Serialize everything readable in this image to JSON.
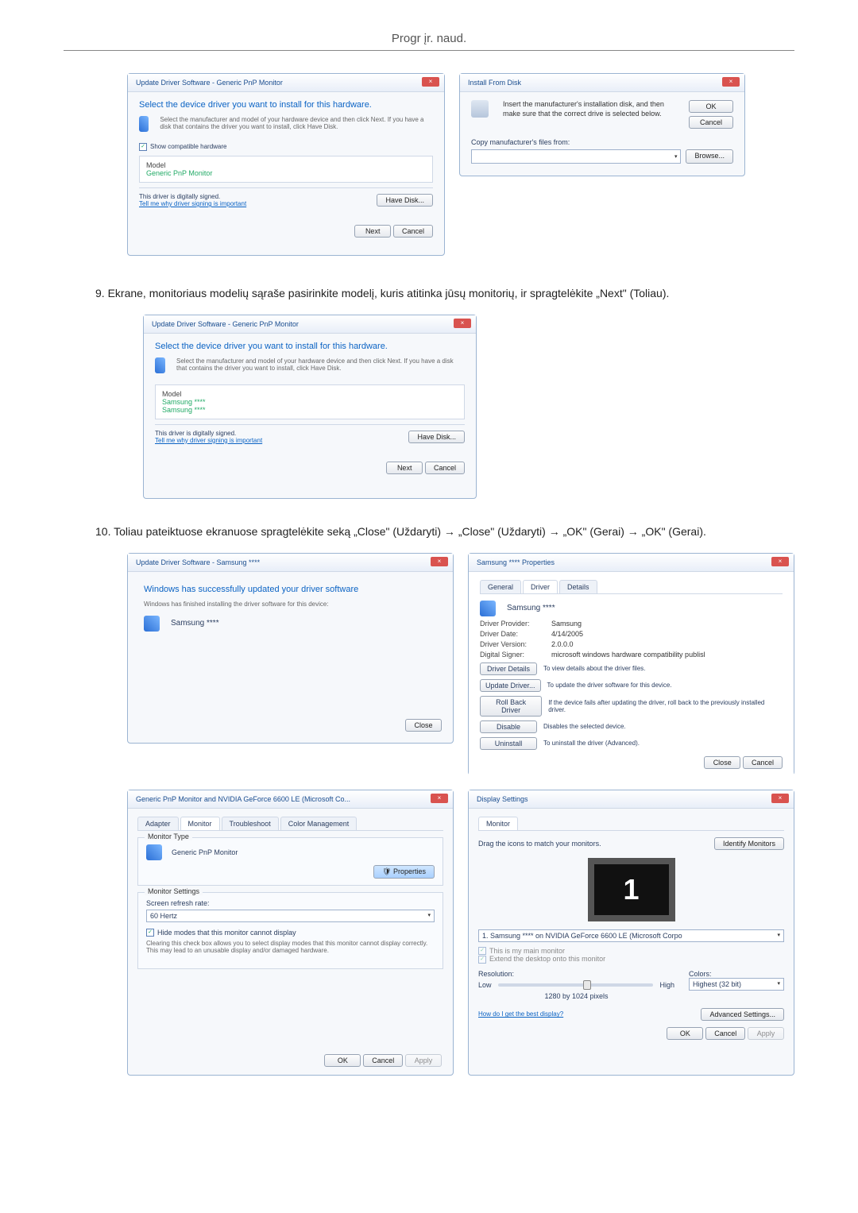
{
  "page_header": "Progr įr. naud.",
  "step9": "9.   Ekrane, monitoriaus modelių sąraše pasirinkite modelį, kuris atitinka jūsų monitorių, ir spragtelėkite „Next\" (Toliau).",
  "step10": "10.  Toliau pateiktuose ekranuose spragtelėkite seką „Close\" (Uždaryti) → „Close\" (Uždaryti) → „OK\" (Gerai) → „OK\" (Gerai).",
  "wiz1": {
    "title": "Update Driver Software - Generic PnP Monitor",
    "hdr": "Select the device driver you want to install for this hardware.",
    "tiny": "Select the manufacturer and model of your hardware device and then click Next. If you have a disk that contains the driver you want to install, click Have Disk.",
    "show_compat": "Show compatible hardware",
    "model_hdr": "Model",
    "model_item": "Generic PnP Monitor",
    "signed": "This driver is digitally signed.",
    "tell_me": "Tell me why driver signing is important",
    "have_disk": "Have Disk...",
    "next": "Next",
    "cancel": "Cancel"
  },
  "install_disk": {
    "title": "Install From Disk",
    "msg": "Insert the manufacturer's installation disk, and then make sure that the correct drive is selected below.",
    "ok": "OK",
    "cancel": "Cancel",
    "copy_label": "Copy manufacturer's files from:",
    "browse": "Browse..."
  },
  "wiz2": {
    "title": "Update Driver Software - Generic PnP Monitor",
    "hdr": "Select the device driver you want to install for this hardware.",
    "tiny": "Select the manufacturer and model of your hardware device and then click Next. If you have a disk that contains the driver you want to install, click Have Disk.",
    "model_hdr": "Model",
    "m1": "Samsung ****",
    "m2": "Samsung ****",
    "signed": "This driver is digitally signed.",
    "tell_me": "Tell me why driver signing is important",
    "have_disk": "Have Disk...",
    "next": "Next",
    "cancel": "Cancel"
  },
  "done": {
    "title": "Update Driver Software - Samsung ****",
    "hdr": "Windows has successfully updated your driver software",
    "sub": "Windows has finished installing the driver software for this device:",
    "dev": "Samsung ****",
    "close": "Close"
  },
  "props": {
    "title": "Samsung **** Properties",
    "tab_general": "General",
    "tab_driver": "Driver",
    "tab_details": "Details",
    "dev": "Samsung ****",
    "provider_k": "Driver Provider:",
    "provider_v": "Samsung",
    "date_k": "Driver Date:",
    "date_v": "4/14/2005",
    "version_k": "Driver Version:",
    "version_v": "2.0.0.0",
    "signer_k": "Digital Signer:",
    "signer_v": "microsoft windows hardware compatibility publisl",
    "b_details": "Driver Details",
    "b_details_d": "To view details about the driver files.",
    "b_update": "Update Driver...",
    "b_update_d": "To update the driver software for this device.",
    "b_rollback": "Roll Back Driver",
    "b_rollback_d": "If the device fails after updating the driver, roll back to the previously installed driver.",
    "b_disable": "Disable",
    "b_disable_d": "Disables the selected device.",
    "b_uninstall": "Uninstall",
    "b_uninstall_d": "To uninstall the driver (Advanced).",
    "close": "Close",
    "cancel": "Cancel"
  },
  "gpu": {
    "title": "Generic PnP Monitor and NVIDIA GeForce 6600 LE (Microsoft Co...",
    "tab_adapter": "Adapter",
    "tab_monitor": "Monitor",
    "tab_troubleshoot": "Troubleshoot",
    "tab_color": "Color Management",
    "grp_type": "Monitor Type",
    "dev": "Generic PnP Monitor",
    "props_btn": "Properties",
    "grp_settings": "Monitor Settings",
    "refresh_lbl": "Screen refresh rate:",
    "refresh_val": "60 Hertz",
    "hide": "Hide modes that this monitor cannot display",
    "note": "Clearing this check box allows you to select display modes that this monitor cannot display correctly. This may lead to an unusable display and/or damaged hardware.",
    "ok": "OK",
    "cancel": "Cancel",
    "apply": "Apply"
  },
  "disp": {
    "title": "Display Settings",
    "tab_monitor": "Monitor",
    "drag": "Drag the icons to match your monitors.",
    "identify": "Identify Monitors",
    "num": "1",
    "combo": "1. Samsung **** on NVIDIA GeForce 6600 LE (Microsoft Corpo",
    "this_main": "This is my main monitor",
    "extend": "Extend the desktop onto this monitor",
    "res_lbl": "Resolution:",
    "low": "Low",
    "high": "High",
    "res_val": "1280 by 1024 pixels",
    "colors_lbl": "Colors:",
    "colors_val": "Highest (32 bit)",
    "best": "How do I get the best display?",
    "adv": "Advanced Settings...",
    "ok": "OK",
    "cancel": "Cancel",
    "apply": "Apply"
  }
}
